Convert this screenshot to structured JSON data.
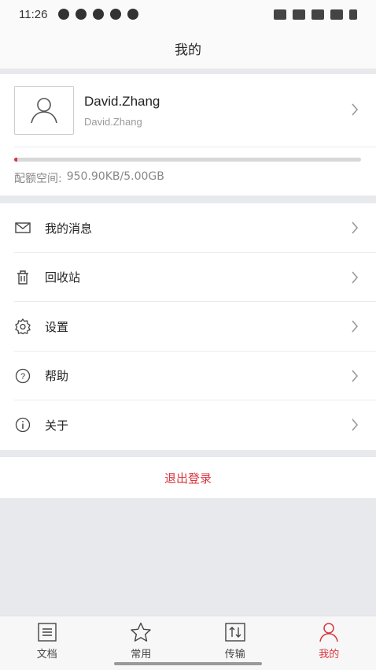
{
  "status_bar": {
    "time": "11:26"
  },
  "header": {
    "title": "我的"
  },
  "profile": {
    "name": "David.Zhang",
    "subtitle": "David.Zhang",
    "quota_label": "配额空间:",
    "quota_value": "950.90KB/5.00GB",
    "quota_fraction": 0.0002
  },
  "menu": [
    {
      "label": "我的消息",
      "icon": "mail-icon"
    },
    {
      "label": "回收站",
      "icon": "trash-icon"
    },
    {
      "label": "设置",
      "icon": "gear-icon"
    },
    {
      "label": "帮助",
      "icon": "help-icon"
    },
    {
      "label": "关于",
      "icon": "info-icon"
    }
  ],
  "logout_label": "退出登录",
  "bottom_nav": [
    {
      "label": "文档",
      "icon": "document-icon",
      "active": false
    },
    {
      "label": "常用",
      "icon": "star-icon",
      "active": false
    },
    {
      "label": "传输",
      "icon": "transfer-icon",
      "active": false
    },
    {
      "label": "我的",
      "icon": "person-icon",
      "active": true
    }
  ],
  "colors": {
    "accent": "#d9363e",
    "background": "#e8e9ec"
  }
}
